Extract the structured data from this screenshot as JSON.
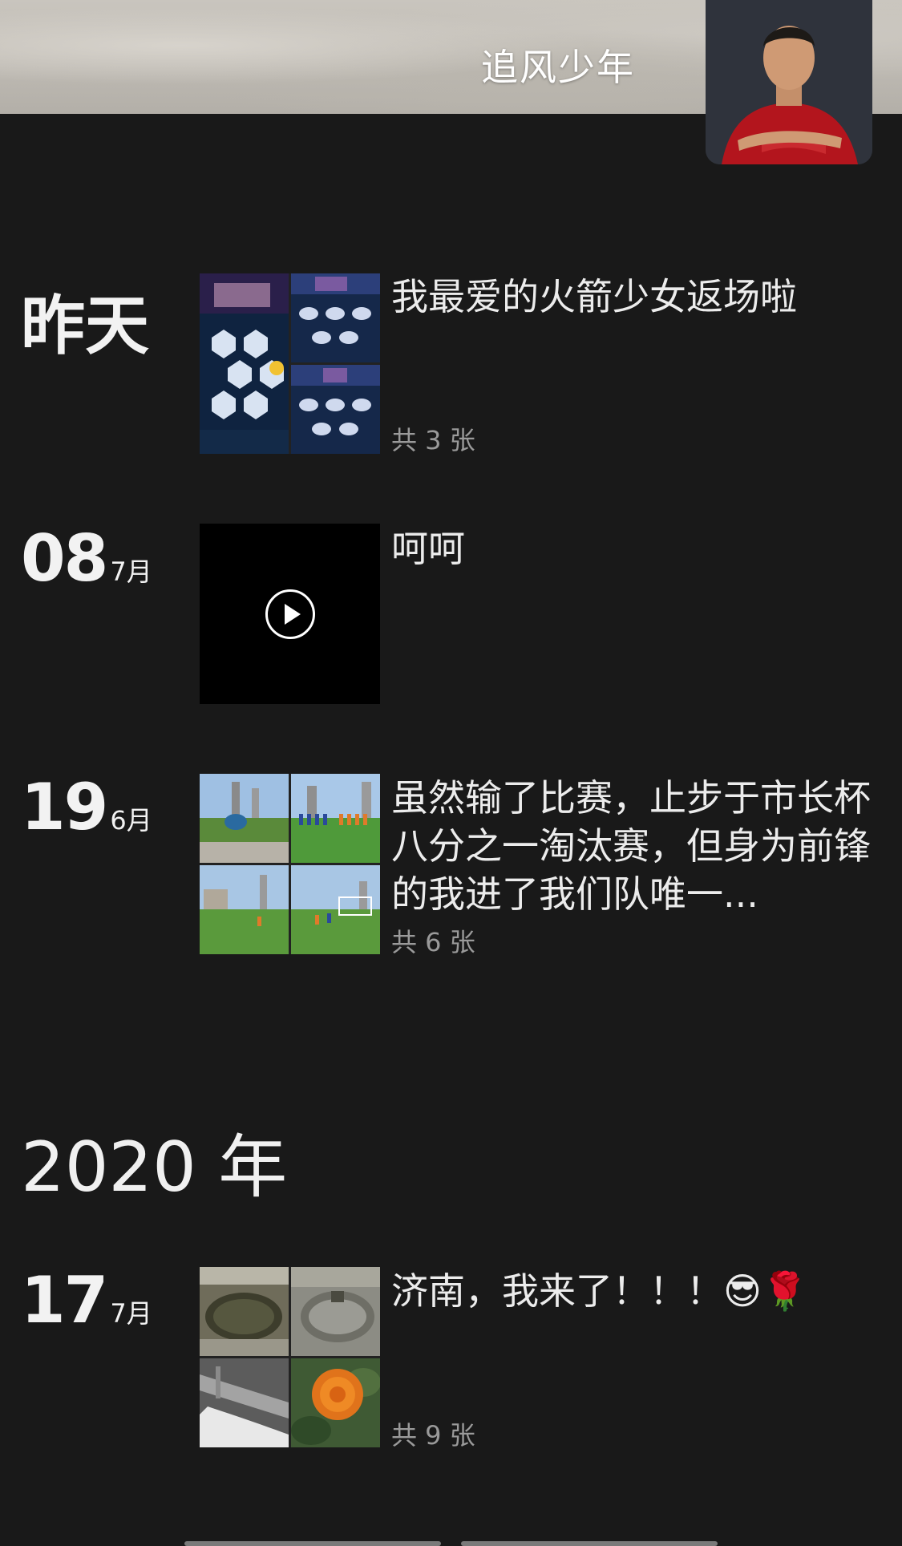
{
  "header": {
    "user_name": "追风少年"
  },
  "feed": {
    "year_2020": "2020 年",
    "posts": [
      {
        "date_label": "昨天",
        "text": "我最爱的火箭少女返场啦",
        "count": "共 3 张",
        "type": "images"
      },
      {
        "day": "08",
        "month": "7月",
        "text": "呵呵",
        "type": "video"
      },
      {
        "day": "19",
        "month": "6月",
        "text": "虽然输了比赛，止步于市长杯八分之一淘汰赛，但身为前锋的我进了我们队唯一...",
        "count": "共 6 张",
        "type": "images"
      },
      {
        "day": "17",
        "month": "7月",
        "text": "济南，我来了！！！",
        "emoji": "😎🌹",
        "count": "共 9 张",
        "type": "images"
      }
    ]
  },
  "icons": {
    "play": "play-icon"
  },
  "colors": {
    "background": "#191919",
    "text": "#ececec",
    "muted": "#9a9a9a"
  }
}
